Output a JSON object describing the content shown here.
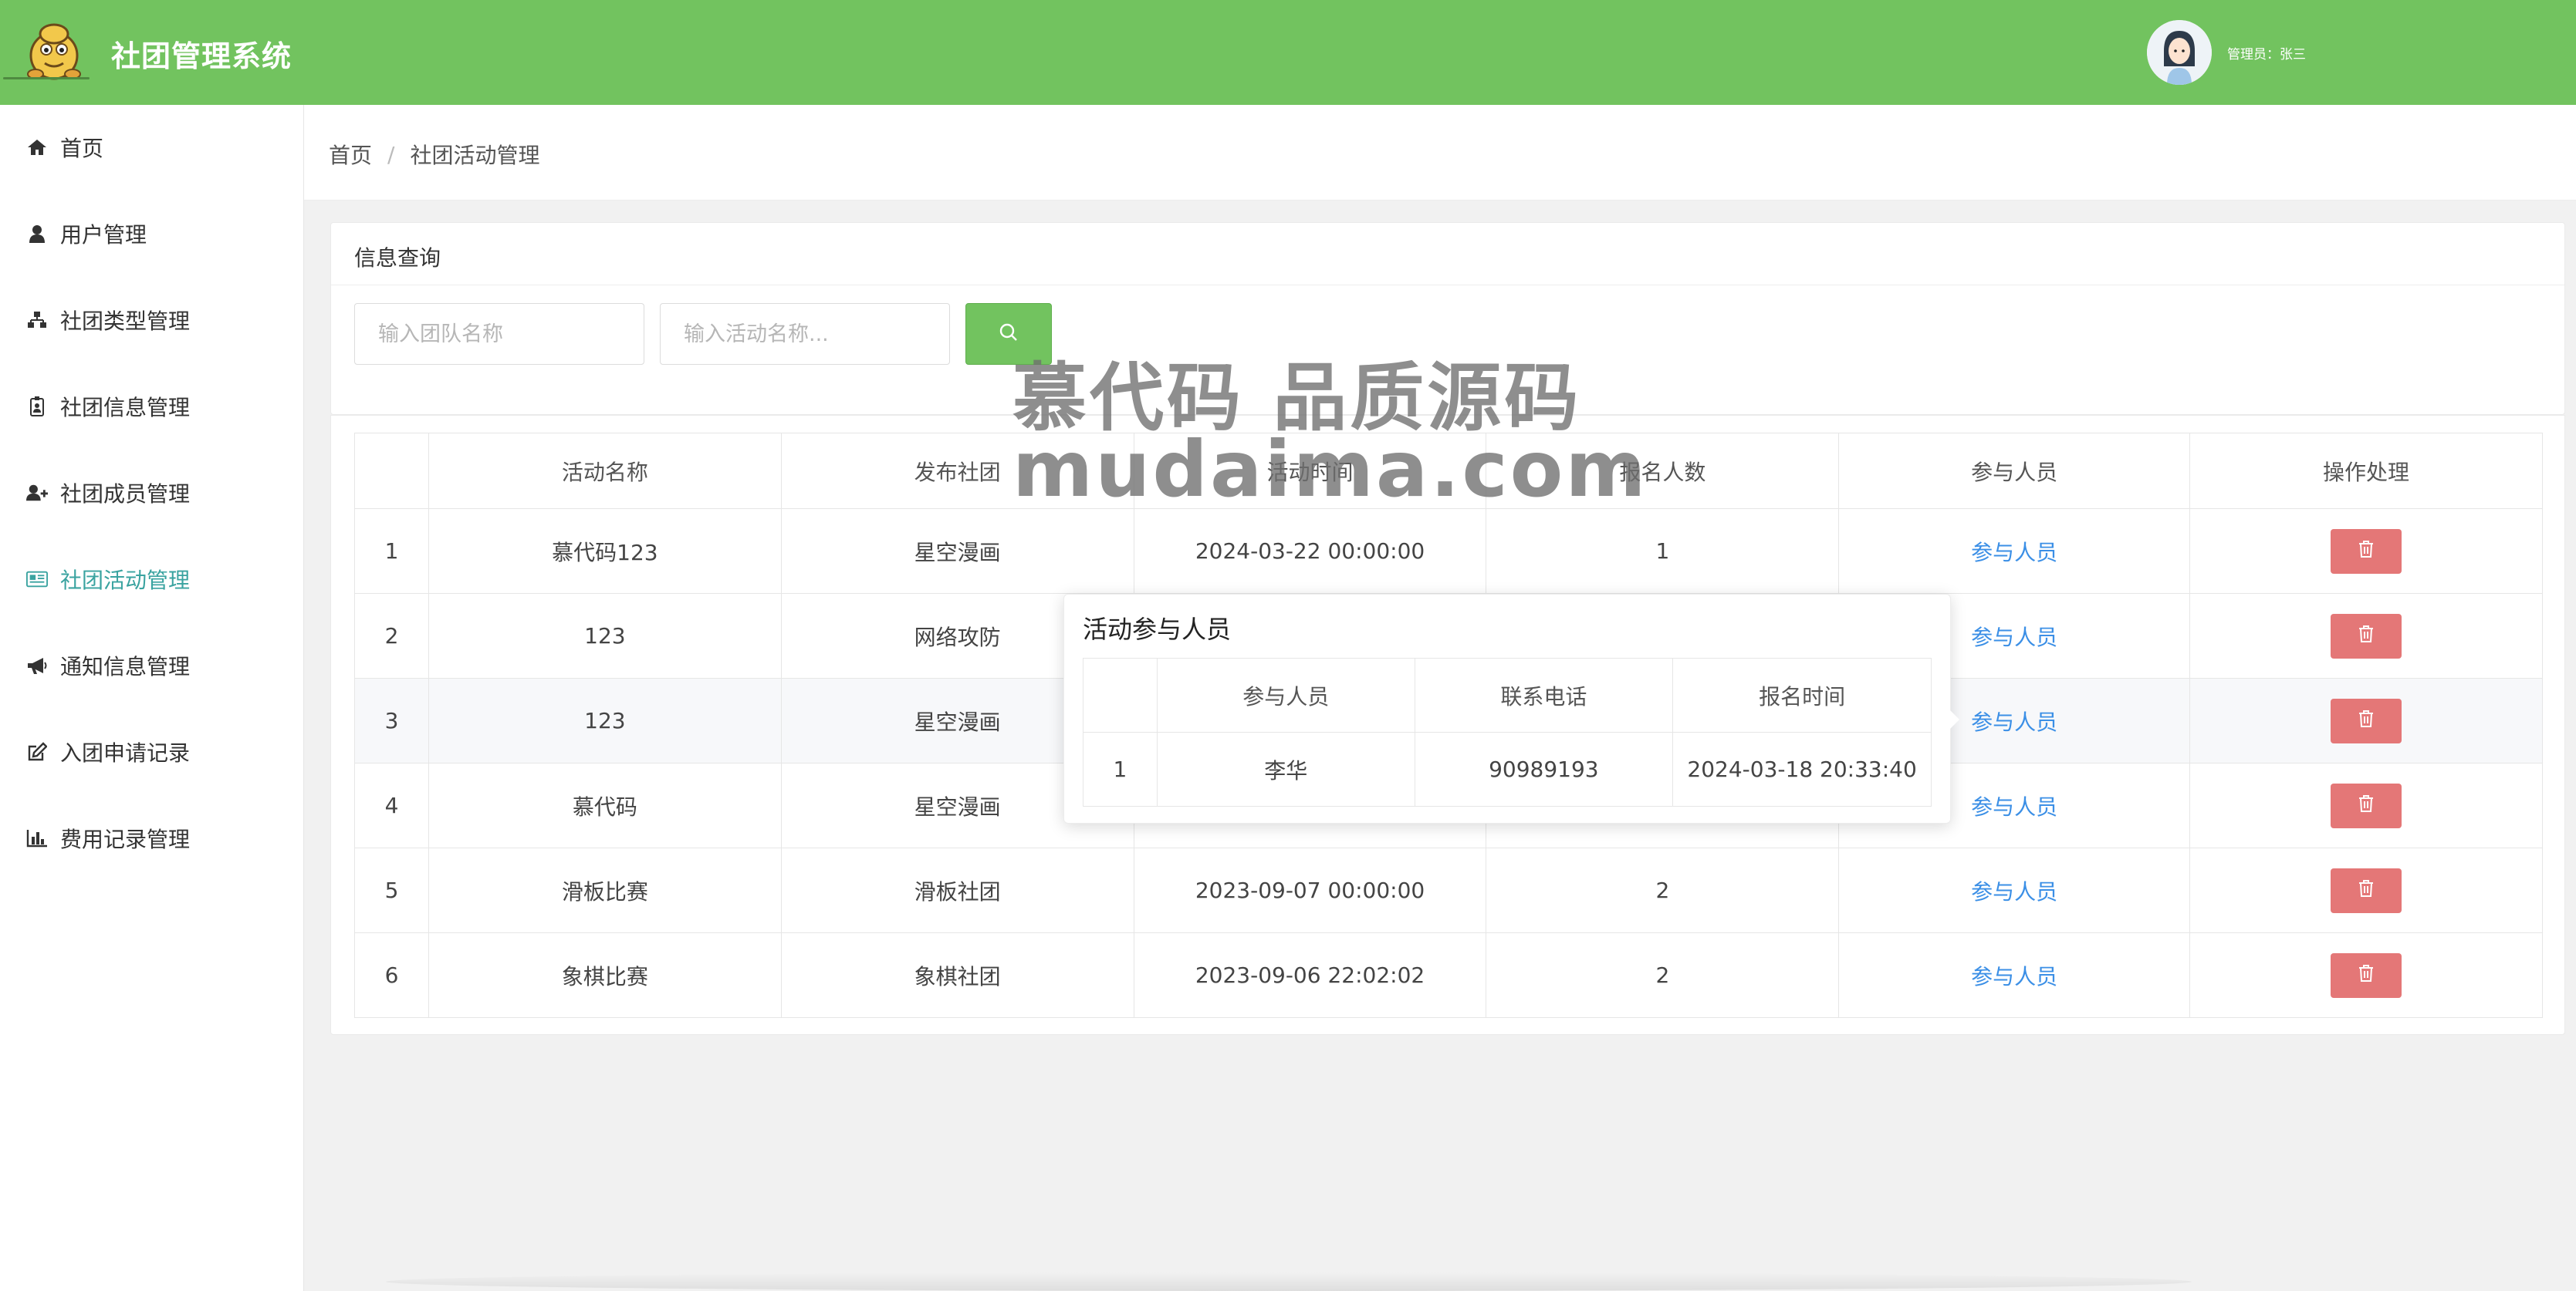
{
  "app": {
    "title": "社团管理系统",
    "admin_label": "管理员：张三"
  },
  "sidebar": {
    "items": [
      {
        "label": "首页",
        "icon": "home-icon"
      },
      {
        "label": "用户管理",
        "icon": "user-icon"
      },
      {
        "label": "社团类型管理",
        "icon": "sitemap-icon"
      },
      {
        "label": "社团信息管理",
        "icon": "id-card-icon"
      },
      {
        "label": "社团成员管理",
        "icon": "user-plus-icon"
      },
      {
        "label": "社团活动管理",
        "icon": "newspaper-icon",
        "active": true
      },
      {
        "label": "通知信息管理",
        "icon": "bullhorn-icon"
      },
      {
        "label": "入团申请记录",
        "icon": "edit-icon"
      },
      {
        "label": "费用记录管理",
        "icon": "bar-chart-icon"
      }
    ]
  },
  "breadcrumb": {
    "home": "首页",
    "sep": "/",
    "current": "社团活动管理"
  },
  "query": {
    "title": "信息查询",
    "team_placeholder": "输入团队名称",
    "activity_placeholder": "输入活动名称..."
  },
  "table": {
    "headers": [
      "",
      "活动名称",
      "发布社团",
      "活动时间",
      "报名人数",
      "参与人员",
      "操作处理"
    ],
    "link_label": "参与人员",
    "rows": [
      {
        "idx": "1",
        "name": "慕代码123",
        "club": "星空漫画",
        "time": "2024-03-22 00:00:00",
        "count": "1"
      },
      {
        "idx": "2",
        "name": "123",
        "club": "网络攻防",
        "time": "",
        "count": ""
      },
      {
        "idx": "3",
        "name": "123",
        "club": "星空漫画",
        "time": "",
        "count": ""
      },
      {
        "idx": "4",
        "name": "慕代码",
        "club": "星空漫画",
        "time": "",
        "count": ""
      },
      {
        "idx": "5",
        "name": "滑板比赛",
        "club": "滑板社团",
        "time": "2023-09-07 00:00:00",
        "count": "2"
      },
      {
        "idx": "6",
        "name": "象棋比赛",
        "club": "象棋社团",
        "time": "2023-09-06 22:02:02",
        "count": "2"
      }
    ]
  },
  "popup": {
    "title": "活动参与人员",
    "headers": [
      "",
      "参与人员",
      "联系电话",
      "报名时间"
    ],
    "rows": [
      {
        "idx": "1",
        "name": "李华",
        "phone": "90989193",
        "time": "2024-03-18 20:33:40"
      }
    ]
  },
  "watermark": {
    "line1": "慕代码 品质源码",
    "line2": "mudaima.com"
  },
  "colors": {
    "header": "#72c35f",
    "active": "#3aa3a0",
    "link": "#3b8fe6",
    "delete": "#e47777"
  }
}
